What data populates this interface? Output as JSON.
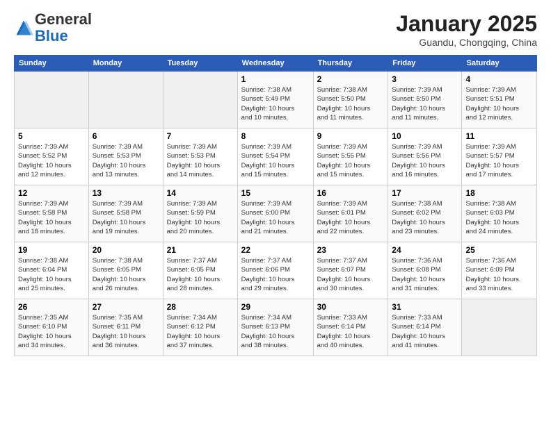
{
  "header": {
    "logo": {
      "general": "General",
      "blue": "Blue"
    },
    "title": "January 2025",
    "subtitle": "Guandu, Chongqing, China"
  },
  "weekdays": [
    "Sunday",
    "Monday",
    "Tuesday",
    "Wednesday",
    "Thursday",
    "Friday",
    "Saturday"
  ],
  "weeks": [
    [
      {
        "day": "",
        "info": ""
      },
      {
        "day": "",
        "info": ""
      },
      {
        "day": "",
        "info": ""
      },
      {
        "day": "1",
        "info": "Sunrise: 7:38 AM\nSunset: 5:49 PM\nDaylight: 10 hours\nand 10 minutes."
      },
      {
        "day": "2",
        "info": "Sunrise: 7:38 AM\nSunset: 5:50 PM\nDaylight: 10 hours\nand 11 minutes."
      },
      {
        "day": "3",
        "info": "Sunrise: 7:39 AM\nSunset: 5:50 PM\nDaylight: 10 hours\nand 11 minutes."
      },
      {
        "day": "4",
        "info": "Sunrise: 7:39 AM\nSunset: 5:51 PM\nDaylight: 10 hours\nand 12 minutes."
      }
    ],
    [
      {
        "day": "5",
        "info": "Sunrise: 7:39 AM\nSunset: 5:52 PM\nDaylight: 10 hours\nand 12 minutes."
      },
      {
        "day": "6",
        "info": "Sunrise: 7:39 AM\nSunset: 5:53 PM\nDaylight: 10 hours\nand 13 minutes."
      },
      {
        "day": "7",
        "info": "Sunrise: 7:39 AM\nSunset: 5:53 PM\nDaylight: 10 hours\nand 14 minutes."
      },
      {
        "day": "8",
        "info": "Sunrise: 7:39 AM\nSunset: 5:54 PM\nDaylight: 10 hours\nand 15 minutes."
      },
      {
        "day": "9",
        "info": "Sunrise: 7:39 AM\nSunset: 5:55 PM\nDaylight: 10 hours\nand 15 minutes."
      },
      {
        "day": "10",
        "info": "Sunrise: 7:39 AM\nSunset: 5:56 PM\nDaylight: 10 hours\nand 16 minutes."
      },
      {
        "day": "11",
        "info": "Sunrise: 7:39 AM\nSunset: 5:57 PM\nDaylight: 10 hours\nand 17 minutes."
      }
    ],
    [
      {
        "day": "12",
        "info": "Sunrise: 7:39 AM\nSunset: 5:58 PM\nDaylight: 10 hours\nand 18 minutes."
      },
      {
        "day": "13",
        "info": "Sunrise: 7:39 AM\nSunset: 5:58 PM\nDaylight: 10 hours\nand 19 minutes."
      },
      {
        "day": "14",
        "info": "Sunrise: 7:39 AM\nSunset: 5:59 PM\nDaylight: 10 hours\nand 20 minutes."
      },
      {
        "day": "15",
        "info": "Sunrise: 7:39 AM\nSunset: 6:00 PM\nDaylight: 10 hours\nand 21 minutes."
      },
      {
        "day": "16",
        "info": "Sunrise: 7:39 AM\nSunset: 6:01 PM\nDaylight: 10 hours\nand 22 minutes."
      },
      {
        "day": "17",
        "info": "Sunrise: 7:38 AM\nSunset: 6:02 PM\nDaylight: 10 hours\nand 23 minutes."
      },
      {
        "day": "18",
        "info": "Sunrise: 7:38 AM\nSunset: 6:03 PM\nDaylight: 10 hours\nand 24 minutes."
      }
    ],
    [
      {
        "day": "19",
        "info": "Sunrise: 7:38 AM\nSunset: 6:04 PM\nDaylight: 10 hours\nand 25 minutes."
      },
      {
        "day": "20",
        "info": "Sunrise: 7:38 AM\nSunset: 6:05 PM\nDaylight: 10 hours\nand 26 minutes."
      },
      {
        "day": "21",
        "info": "Sunrise: 7:37 AM\nSunset: 6:05 PM\nDaylight: 10 hours\nand 28 minutes."
      },
      {
        "day": "22",
        "info": "Sunrise: 7:37 AM\nSunset: 6:06 PM\nDaylight: 10 hours\nand 29 minutes."
      },
      {
        "day": "23",
        "info": "Sunrise: 7:37 AM\nSunset: 6:07 PM\nDaylight: 10 hours\nand 30 minutes."
      },
      {
        "day": "24",
        "info": "Sunrise: 7:36 AM\nSunset: 6:08 PM\nDaylight: 10 hours\nand 31 minutes."
      },
      {
        "day": "25",
        "info": "Sunrise: 7:36 AM\nSunset: 6:09 PM\nDaylight: 10 hours\nand 33 minutes."
      }
    ],
    [
      {
        "day": "26",
        "info": "Sunrise: 7:35 AM\nSunset: 6:10 PM\nDaylight: 10 hours\nand 34 minutes."
      },
      {
        "day": "27",
        "info": "Sunrise: 7:35 AM\nSunset: 6:11 PM\nDaylight: 10 hours\nand 36 minutes."
      },
      {
        "day": "28",
        "info": "Sunrise: 7:34 AM\nSunset: 6:12 PM\nDaylight: 10 hours\nand 37 minutes."
      },
      {
        "day": "29",
        "info": "Sunrise: 7:34 AM\nSunset: 6:13 PM\nDaylight: 10 hours\nand 38 minutes."
      },
      {
        "day": "30",
        "info": "Sunrise: 7:33 AM\nSunset: 6:14 PM\nDaylight: 10 hours\nand 40 minutes."
      },
      {
        "day": "31",
        "info": "Sunrise: 7:33 AM\nSunset: 6:14 PM\nDaylight: 10 hours\nand 41 minutes."
      },
      {
        "day": "",
        "info": ""
      }
    ]
  ]
}
